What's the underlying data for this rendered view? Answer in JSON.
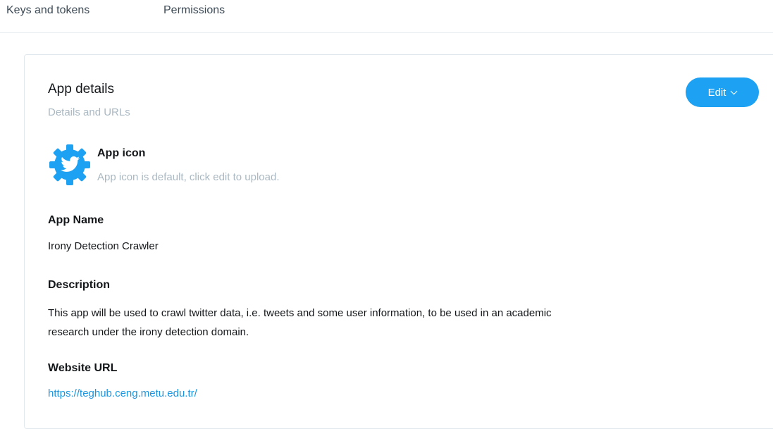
{
  "tabs": [
    {
      "label": "Keys and tokens"
    },
    {
      "label": "Permissions"
    }
  ],
  "card": {
    "title": "App details",
    "subtitle": "Details and URLs",
    "edit_label": "Edit",
    "app_icon": {
      "label": "App icon",
      "hint": "App icon is default, click edit to upload.",
      "icon": "twitter-gear-icon"
    },
    "fields": {
      "app_name": {
        "label": "App Name",
        "value": "Irony Detection Crawler"
      },
      "description": {
        "label": "Description",
        "value": "This app will be used to crawl twitter data, i.e. tweets and some user information, to be used in an academic research under the irony detection domain."
      },
      "website": {
        "label": "Website URL",
        "value": "https://teghub.ceng.metu.edu.tr/"
      }
    }
  },
  "colors": {
    "accent": "#1da1f2",
    "link": "#1b95e0",
    "muted": "#aab8c2"
  }
}
